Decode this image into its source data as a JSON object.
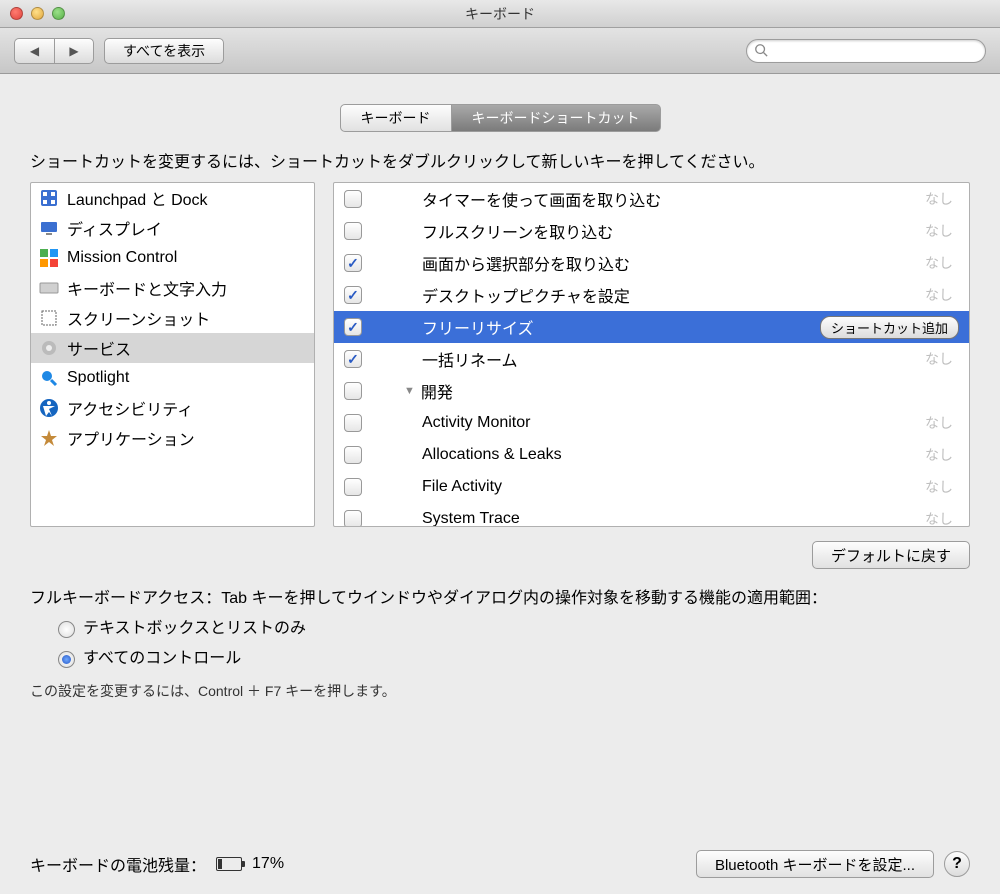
{
  "window": {
    "title": "キーボード"
  },
  "toolbar": {
    "show_all": "すべてを表示",
    "search_placeholder": ""
  },
  "tabs": [
    {
      "label": "キーボード",
      "active": false
    },
    {
      "label": "キーボードショートカット",
      "active": true
    }
  ],
  "instruction": "ショートカットを変更するには、ショートカットをダブルクリックして新しいキーを押してください。",
  "categories": [
    {
      "label": "Launchpad と Dock",
      "selected": false,
      "icon": "launchpad",
      "color": "#3a6fd1"
    },
    {
      "label": "ディスプレイ",
      "selected": false,
      "icon": "display",
      "color": "#3a6fd1"
    },
    {
      "label": "Mission Control",
      "selected": false,
      "icon": "mission",
      "color": "#2e7d32"
    },
    {
      "label": "キーボードと文字入力",
      "selected": false,
      "icon": "keyboard",
      "color": "#888"
    },
    {
      "label": "スクリーンショット",
      "selected": false,
      "icon": "screenshot",
      "color": "#777"
    },
    {
      "label": "サービス",
      "selected": true,
      "icon": "services",
      "color": "#777"
    },
    {
      "label": "Spotlight",
      "selected": false,
      "icon": "spotlight",
      "color": "#1e88e5"
    },
    {
      "label": "アクセシビリティ",
      "selected": false,
      "icon": "accessibility",
      "color": "#1565c0"
    },
    {
      "label": "アプリケーション",
      "selected": false,
      "icon": "applications",
      "color": "#c48a3a"
    }
  ],
  "shortcuts": [
    {
      "checked": false,
      "indent": 1,
      "label": "タイマーを使って画面を取り込む",
      "short": "なし",
      "selected": false
    },
    {
      "checked": false,
      "indent": 1,
      "label": "フルスクリーンを取り込む",
      "short": "なし",
      "selected": false
    },
    {
      "checked": true,
      "indent": 1,
      "label": "画面から選択部分を取り込む",
      "short": "なし",
      "selected": false
    },
    {
      "checked": true,
      "indent": 1,
      "label": "デスクトップピクチャを設定",
      "short": "なし",
      "selected": false
    },
    {
      "checked": true,
      "indent": 1,
      "label": "フリーリサイズ",
      "short": "",
      "selected": true,
      "add_btn": "ショートカット追加"
    },
    {
      "checked": true,
      "indent": 1,
      "label": "一括リネーム",
      "short": "なし",
      "selected": false
    },
    {
      "group": true,
      "indent": 0,
      "label": "開発",
      "checked": false
    },
    {
      "checked": false,
      "indent": 1,
      "label": "Activity Monitor",
      "short": "なし",
      "selected": false
    },
    {
      "checked": false,
      "indent": 1,
      "label": "Allocations & Leaks",
      "short": "なし",
      "selected": false
    },
    {
      "checked": false,
      "indent": 1,
      "label": "File Activity",
      "short": "なし",
      "selected": false
    },
    {
      "checked": false,
      "indent": 1,
      "label": "System Trace",
      "short": "なし",
      "selected": false
    }
  ],
  "restore_defaults": "デフォルトに戻す",
  "kb_access": {
    "text": "フルキーボードアクセス：Tab キーを押してウインドウやダイアログ内の操作対象を移動する機能の適用範囲：",
    "option1": "テキストボックスとリストのみ",
    "option2": "すべてのコントロール",
    "selected": 2,
    "note": "この設定を変更するには、Control ＋ F7 キーを押します。"
  },
  "footer": {
    "battery_label": "キーボードの電池残量：",
    "battery_pct": "17%",
    "bluetooth_btn": "Bluetooth キーボードを設定...",
    "help": "?"
  }
}
